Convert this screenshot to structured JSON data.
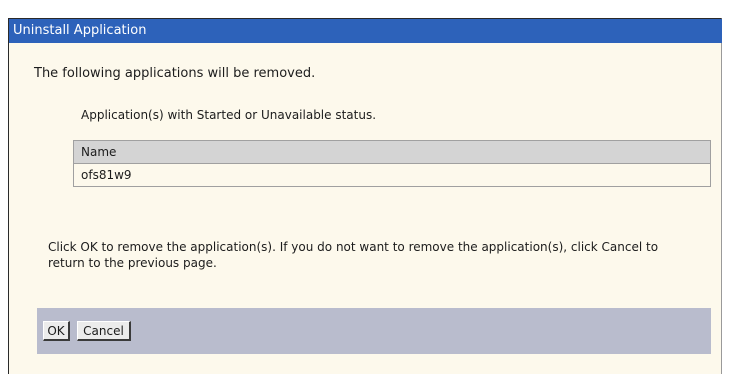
{
  "window": {
    "title": "Uninstall Application"
  },
  "main": {
    "intro_text": "The following applications will be removed.",
    "subtitle": "Application(s) with Started or Unavailable status.",
    "table": {
      "header": "Name",
      "rows": [
        "ofs81w9"
      ]
    },
    "instruction": "Click OK to remove the application(s). If you do not want to remove the application(s), click Cancel to return to the previous page."
  },
  "buttons": {
    "ok_label": "OK",
    "cancel_label": "Cancel"
  },
  "colors": {
    "title_bar": "#2d62ba",
    "content_bg": "#fdf9ec",
    "button_bar": "#b9bccd",
    "table_header": "#d4d4d4"
  }
}
